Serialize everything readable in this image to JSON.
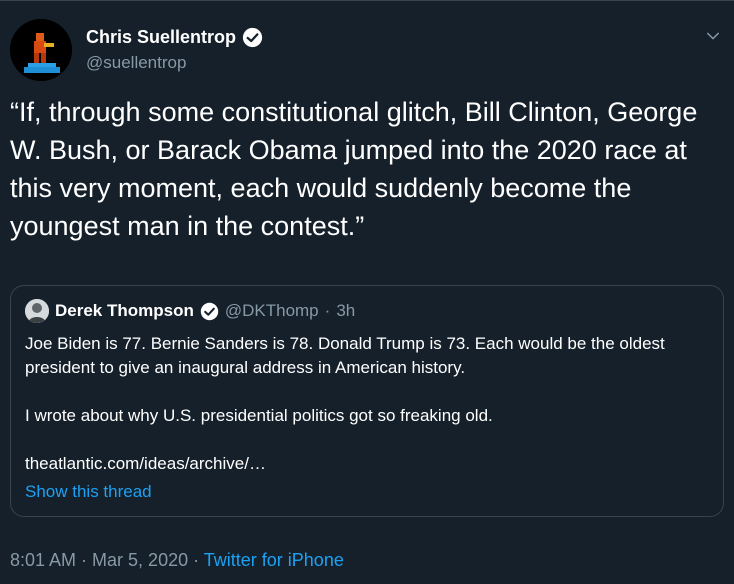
{
  "tweet": {
    "author": {
      "display_name": "Chris Suellentrop",
      "handle": "@suellentrop",
      "verified": true
    },
    "text": "“If, through some constitutional glitch, Bill Clinton, George W. Bush, or Barack Obama jumped into the 2020 race at this very moment, each would suddenly become the youngest man in the contest.”",
    "quoted": {
      "display_name": "Derek Thompson",
      "handle": "@DKThomp",
      "separator": "·",
      "time": "3h",
      "paragraphs": [
        "Joe Biden is 77. Bernie Sanders is 78. Donald Trump is 73. Each would be the oldest president to give an inaugural address in American history.",
        "I wrote about why U.S. presidential politics got so freaking old.",
        "theatlantic.com/ideas/archive/…"
      ],
      "show_thread": "Show this thread"
    },
    "footer": {
      "time": "8:01 AM",
      "sep1": " · ",
      "date": "Mar 5, 2020",
      "sep2": " · ",
      "source": "Twitter for iPhone"
    }
  },
  "colors": {
    "background": "#15202b",
    "border": "#38444d",
    "secondary_text": "#8899a6",
    "link": "#1da1f2"
  },
  "icons": {
    "verified": "verified-badge-icon",
    "menu": "chevron-down-icon"
  }
}
